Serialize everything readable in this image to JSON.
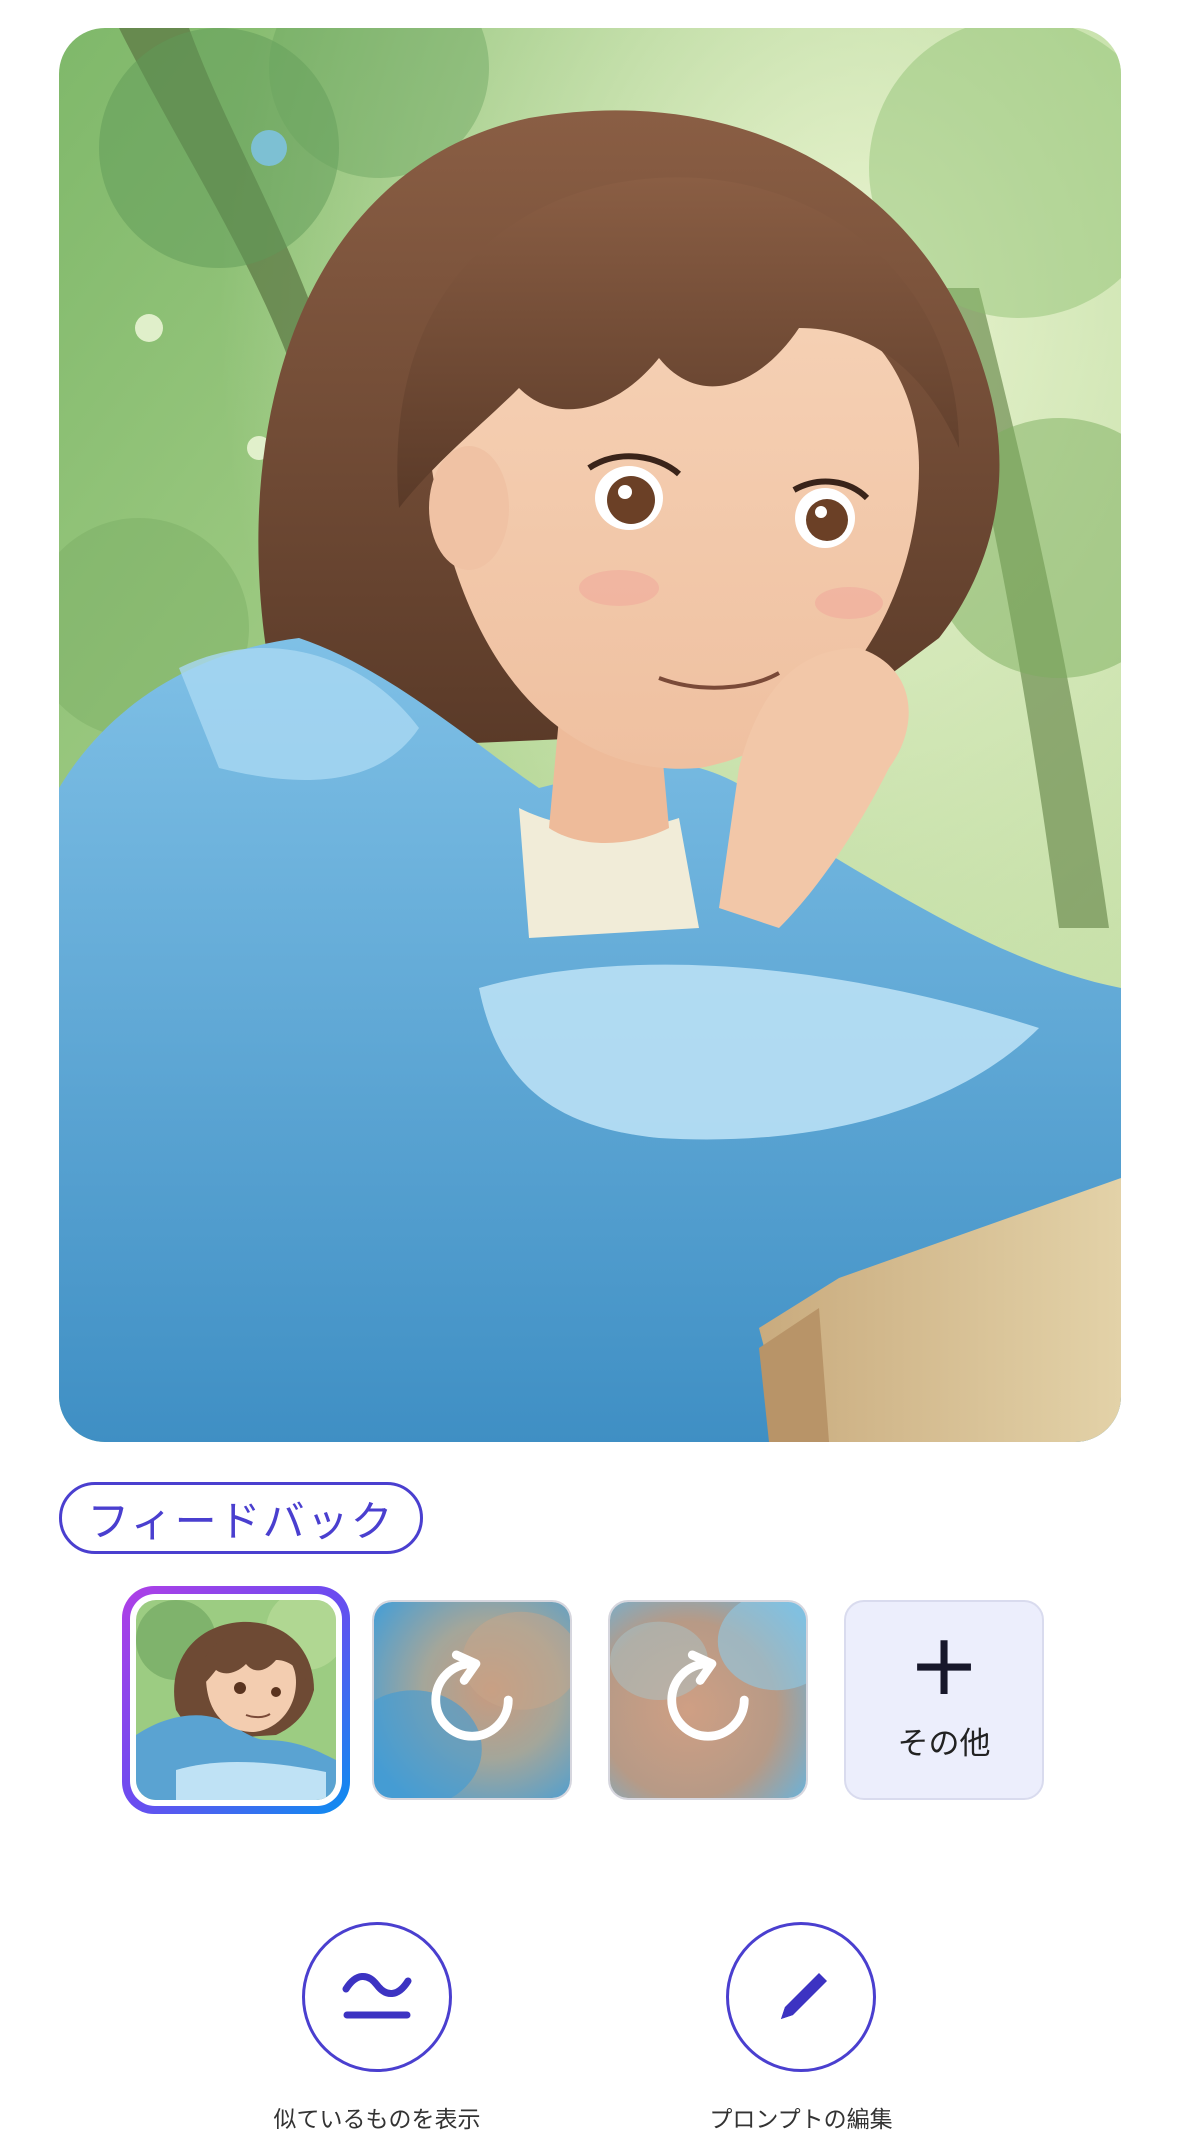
{
  "feedback": {
    "label": "フィードバック"
  },
  "variants": {
    "more_label": "その他",
    "more_icon": "plus-icon",
    "regenerate_icon": "refresh-icon"
  },
  "actions": {
    "similar_label": "似ているものを表示",
    "similar_icon": "approx-equal-icon",
    "edit_prompt_label": "プロンプトの編集",
    "edit_prompt_icon": "pencil-icon"
  },
  "colors": {
    "accent": "#4a3fcf",
    "selected_gradient_start": "#b03fe6",
    "selected_gradient_end": "#0b8ef0",
    "more_tile_bg": "#eceefc"
  }
}
